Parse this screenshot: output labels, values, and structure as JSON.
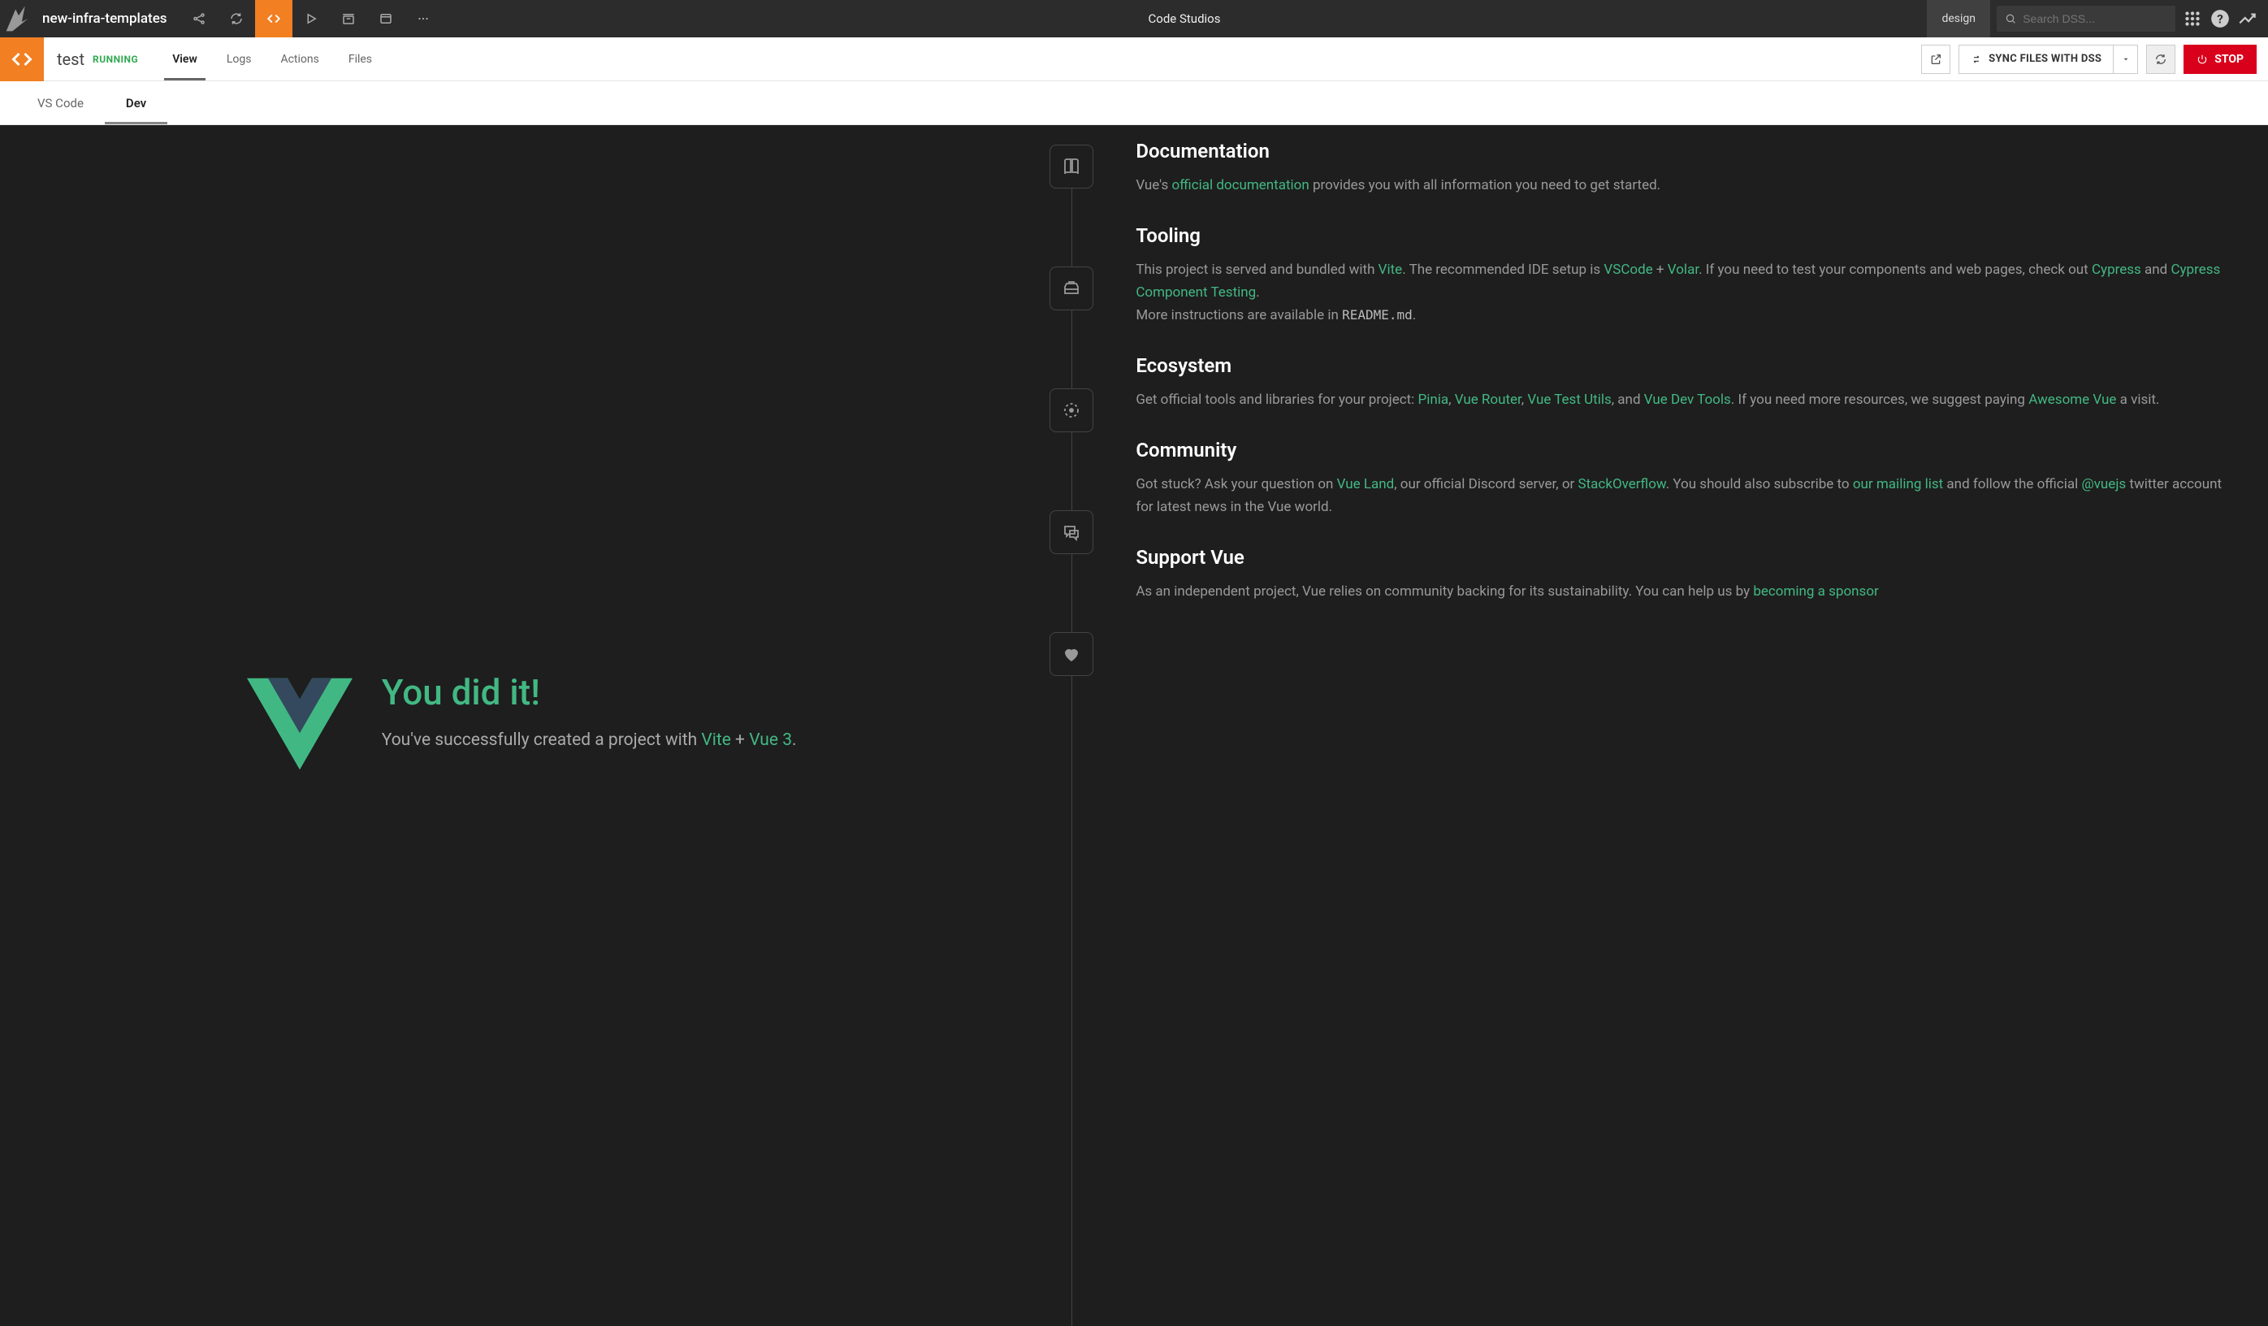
{
  "topbar": {
    "project_name": "new-infra-templates",
    "breadcrumb": "Code Studios",
    "mode": "design",
    "search_placeholder": "Search DSS..."
  },
  "secondbar": {
    "studio_name": "test",
    "status": "RUNNING",
    "tabs": [
      "View",
      "Logs",
      "Actions",
      "Files"
    ],
    "active_tab": "View",
    "sync_label": "SYNC FILES WITH DSS",
    "stop_label": "STOP"
  },
  "thirdbar": {
    "tabs": [
      "VS Code",
      "Dev"
    ],
    "active_tab": "Dev"
  },
  "hero": {
    "title": "You did it!",
    "subtitle_pre": "You've successfully created a project with ",
    "vite": "Vite",
    "plus": " + ",
    "vue3": "Vue 3",
    "dot": "."
  },
  "docs": {
    "documentation": {
      "title": "Documentation",
      "t1": "Vue's ",
      "link1": "official documentation",
      "t2": " provides you with all information you need to get started."
    },
    "tooling": {
      "title": "Tooling",
      "t1": "This project is served and bundled with ",
      "vite": "Vite",
      "t2": ". The recommended IDE setup is ",
      "vscode": "VSCode",
      "plus": " + ",
      "volar": "Volar",
      "t3": ". If you need to test your components and web pages, check out ",
      "cypress": "Cypress",
      "and": " and ",
      "cct": "Cypress Component Testing",
      "t4": ".",
      "t5": "More instructions are available in ",
      "readme": "README.md",
      "t6": "."
    },
    "ecosystem": {
      "title": "Ecosystem",
      "t1": "Get official tools and libraries for your project: ",
      "pinia": "Pinia",
      "c1": ", ",
      "router": "Vue Router",
      "c2": ", ",
      "vtu": "Vue Test Utils",
      "c3": ", and ",
      "devtools": "Vue Dev Tools",
      "t2": ". If you need more resources, we suggest paying ",
      "awesome": "Awesome Vue",
      "t3": " a visit."
    },
    "community": {
      "title": "Community",
      "t1": "Got stuck? Ask your question on ",
      "vueland": "Vue Land",
      "t2": ", our official Discord server, or ",
      "so": "StackOverflow",
      "t3": ". You should also subscribe to ",
      "ml": "our mailing list",
      "t4": " and follow the official ",
      "tw": "@vuejs",
      "t5": " twitter account for latest news in the Vue world."
    },
    "support": {
      "title": "Support Vue",
      "t1": "As an independent project, Vue relies on community backing for its ",
      "t2": "sustainability. You can help us by ",
      "sponsor": "becoming a sponsor"
    }
  }
}
